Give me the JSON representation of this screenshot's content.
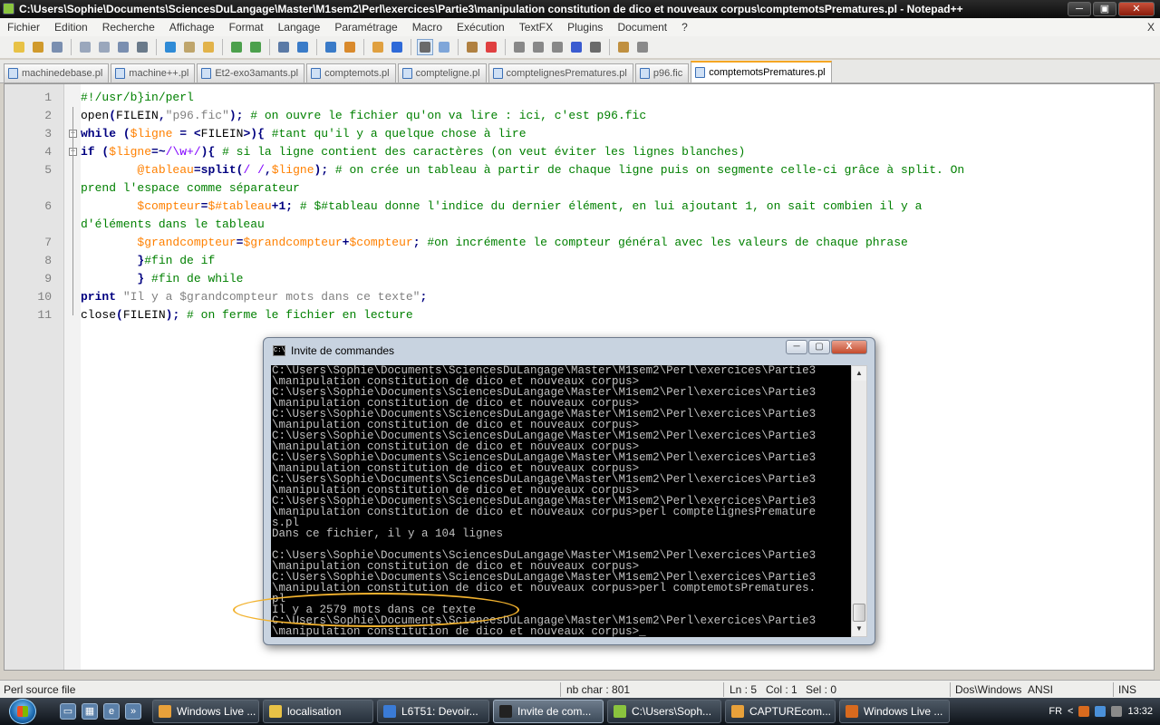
{
  "window": {
    "title": "C:\\Users\\Sophie\\Documents\\SciencesDuLangage\\Master\\M1sem2\\Perl\\exercices\\Partie3\\manipulation constitution de dico et nouveaux corpus\\comptemotsPrematures.pl - Notepad++",
    "buttons": {
      "minimize": "─",
      "maximize": "▣",
      "close": "✕"
    }
  },
  "menu": [
    "Fichier",
    "Edition",
    "Recherche",
    "Affichage",
    "Format",
    "Langage",
    "Paramétrage",
    "Macro",
    "Exécution",
    "TextFX",
    "Plugins",
    "Document",
    "?"
  ],
  "menu_close": "X",
  "toolbar_icon_colors": [
    "#e8c246",
    "#d09a2c",
    "#7a8fb0",
    "#9aa7bc",
    "#9aa7bc",
    "#7a8fb0",
    "#6a7a8a",
    "#2f8bd6",
    "#bfa56b",
    "#e2b34a",
    "#4ca04c",
    "#4ca04c",
    "#5b7aa6",
    "#3a7bc8",
    "#3a7bc8",
    "#d98a2c",
    "#e0a040",
    "#2f6ad8",
    "#6a6a6a",
    "#7fa6d9",
    "#b08040",
    "#e04040",
    "#888888",
    "#888888",
    "#888888",
    "#3a5bd0",
    "#6a6a6a",
    "#c09040",
    "#8a8a8a"
  ],
  "tabs": [
    {
      "label": "machinedebase.pl",
      "selected": false
    },
    {
      "label": "machine++.pl",
      "selected": false
    },
    {
      "label": "Et2-exo3amants.pl",
      "selected": false
    },
    {
      "label": "comptemots.pl",
      "selected": false
    },
    {
      "label": "compteligne.pl",
      "selected": false
    },
    {
      "label": "comptelignesPrematures.pl",
      "selected": false
    },
    {
      "label": "p96.fic",
      "selected": false
    },
    {
      "label": "comptemotsPrematures.pl",
      "selected": true
    }
  ],
  "code_lines": [
    {
      "num": "1",
      "tokens": [
        {
          "t": "#!/usr/b}in/perl",
          "c": "cm"
        }
      ]
    },
    {
      "num": "2",
      "tokens": [
        {
          "t": "open",
          "c": "pl"
        },
        {
          "t": "(",
          "c": "op"
        },
        {
          "t": "FILEIN",
          "c": "pl"
        },
        {
          "t": ",",
          "c": "op"
        },
        {
          "t": "\"p96.fic\"",
          "c": "st"
        },
        {
          "t": "); ",
          "c": "op"
        },
        {
          "t": "# on ouvre le fichier qu'on va lire : ici, c'est p96.fic",
          "c": "cm"
        }
      ]
    },
    {
      "num": "3",
      "tokens": [
        {
          "t": "while",
          "c": "kw"
        },
        {
          "t": " (",
          "c": "op"
        },
        {
          "t": "$ligne",
          "c": "vr"
        },
        {
          "t": " = <",
          "c": "op"
        },
        {
          "t": "FILEIN",
          "c": "pl"
        },
        {
          "t": ">){ ",
          "c": "op"
        },
        {
          "t": "#tant qu'il y a quelque chose à lire",
          "c": "cm"
        }
      ]
    },
    {
      "num": "4",
      "tokens": [
        {
          "t": "if",
          "c": "kw"
        },
        {
          "t": " (",
          "c": "op"
        },
        {
          "t": "$ligne",
          "c": "vr"
        },
        {
          "t": "=~",
          "c": "op"
        },
        {
          "t": "/\\w+/",
          "c": "rx"
        },
        {
          "t": "){ ",
          "c": "op"
        },
        {
          "t": "# si la ligne contient des caractères (on veut éviter les lignes blanches)",
          "c": "cm"
        }
      ]
    },
    {
      "num": "5",
      "tokens": [
        {
          "t": "        ",
          "c": "pl"
        },
        {
          "t": "@tableau",
          "c": "vr"
        },
        {
          "t": "=",
          "c": "op"
        },
        {
          "t": "split",
          "c": "kw"
        },
        {
          "t": "(",
          "c": "op"
        },
        {
          "t": "/ /",
          "c": "rx"
        },
        {
          "t": ",",
          "c": "op"
        },
        {
          "t": "$ligne",
          "c": "vr"
        },
        {
          "t": "); ",
          "c": "op"
        },
        {
          "t": "# on crée un tableau à partir de chaque ligne puis on segmente celle-ci grâce à split. On",
          "c": "cm"
        }
      ]
    },
    {
      "num": "",
      "tokens": [
        {
          "t": "prend l'espace comme séparateur",
          "c": "cm"
        }
      ]
    },
    {
      "num": "6",
      "tokens": [
        {
          "t": "        ",
          "c": "pl"
        },
        {
          "t": "$compteur",
          "c": "vr"
        },
        {
          "t": "=",
          "c": "op"
        },
        {
          "t": "$#tableau",
          "c": "vr"
        },
        {
          "t": "+1; ",
          "c": "op"
        },
        {
          "t": "# $#tableau donne l'indice du dernier élément, en lui ajoutant 1, on sait combien il y a",
          "c": "cm"
        }
      ]
    },
    {
      "num": "",
      "tokens": [
        {
          "t": "d'éléments dans le tableau",
          "c": "cm"
        }
      ]
    },
    {
      "num": "7",
      "tokens": [
        {
          "t": "        ",
          "c": "pl"
        },
        {
          "t": "$grandcompteur",
          "c": "vr"
        },
        {
          "t": "=",
          "c": "op"
        },
        {
          "t": "$grandcompteur",
          "c": "vr"
        },
        {
          "t": "+",
          "c": "op"
        },
        {
          "t": "$compteur",
          "c": "vr"
        },
        {
          "t": "; ",
          "c": "op"
        },
        {
          "t": "#on incrémente le compteur général avec les valeurs de chaque phrase",
          "c": "cm"
        }
      ]
    },
    {
      "num": "8",
      "tokens": [
        {
          "t": "        ",
          "c": "pl"
        },
        {
          "t": "}",
          "c": "op"
        },
        {
          "t": "#fin de if",
          "c": "cm"
        }
      ]
    },
    {
      "num": "9",
      "tokens": [
        {
          "t": "        ",
          "c": "pl"
        },
        {
          "t": "} ",
          "c": "op"
        },
        {
          "t": "#fin de while",
          "c": "cm"
        }
      ]
    },
    {
      "num": "10",
      "tokens": [
        {
          "t": "print",
          "c": "kw"
        },
        {
          "t": " ",
          "c": "pl"
        },
        {
          "t": "\"Il y a $grandcompteur mots dans ce texte\"",
          "c": "st"
        },
        {
          "t": ";",
          "c": "op"
        }
      ]
    },
    {
      "num": "11",
      "tokens": [
        {
          "t": "close",
          "c": "pl"
        },
        {
          "t": "(",
          "c": "op"
        },
        {
          "t": "FILEIN",
          "c": "pl"
        },
        {
          "t": "); ",
          "c": "op"
        },
        {
          "t": "# on ferme le fichier en lecture",
          "c": "cm"
        }
      ]
    }
  ],
  "cmd": {
    "title": "Invite de commandes",
    "icon_label": "C:\\",
    "buttons": {
      "minimize": "─",
      "maximize": "▢",
      "close": "X"
    },
    "lines": [
      "C:\\Users\\Sophie\\Documents\\SciencesDuLangage\\Master\\M1sem2\\Perl\\exercices\\Partie3",
      "\\manipulation constitution de dico et nouveaux corpus>",
      "C:\\Users\\Sophie\\Documents\\SciencesDuLangage\\Master\\M1sem2\\Perl\\exercices\\Partie3",
      "\\manipulation constitution de dico et nouveaux corpus>",
      "C:\\Users\\Sophie\\Documents\\SciencesDuLangage\\Master\\M1sem2\\Perl\\exercices\\Partie3",
      "\\manipulation constitution de dico et nouveaux corpus>",
      "C:\\Users\\Sophie\\Documents\\SciencesDuLangage\\Master\\M1sem2\\Perl\\exercices\\Partie3",
      "\\manipulation constitution de dico et nouveaux corpus>",
      "C:\\Users\\Sophie\\Documents\\SciencesDuLangage\\Master\\M1sem2\\Perl\\exercices\\Partie3",
      "\\manipulation constitution de dico et nouveaux corpus>",
      "C:\\Users\\Sophie\\Documents\\SciencesDuLangage\\Master\\M1sem2\\Perl\\exercices\\Partie3",
      "\\manipulation constitution de dico et nouveaux corpus>",
      "C:\\Users\\Sophie\\Documents\\SciencesDuLangage\\Master\\M1sem2\\Perl\\exercices\\Partie3",
      "\\manipulation constitution de dico et nouveaux corpus>perl comptelignesPremature",
      "s.pl",
      "Dans ce fichier, il y a 104 lignes",
      "",
      "C:\\Users\\Sophie\\Documents\\SciencesDuLangage\\Master\\M1sem2\\Perl\\exercices\\Partie3",
      "\\manipulation constitution de dico et nouveaux corpus>",
      "C:\\Users\\Sophie\\Documents\\SciencesDuLangage\\Master\\M1sem2\\Perl\\exercices\\Partie3",
      "\\manipulation constitution de dico et nouveaux corpus>perl comptemotsPrematures.",
      "pl",
      "Il y a 2579 mots dans ce texte",
      "C:\\Users\\Sophie\\Documents\\SciencesDuLangage\\Master\\M1sem2\\Perl\\exercices\\Partie3",
      "\\manipulation constitution de dico et nouveaux corpus>_"
    ],
    "scroll_up": "▲",
    "scroll_down": "▼",
    "highlight_color": "#f2b22e"
  },
  "status": {
    "file_type": "Perl source file",
    "nb_char": "nb char : 801",
    "ln": "Ln : 5",
    "col": "Col : 1",
    "sel": "Sel : 0",
    "eol": "Dos\\Windows",
    "encoding": "ANSI",
    "mode": "INS"
  },
  "taskbar": {
    "quicklaunch": [
      {
        "icon": "show-desktop-icon",
        "glyph": "▭"
      },
      {
        "icon": "switch-windows-icon",
        "glyph": "▦"
      },
      {
        "icon": "ie-icon",
        "glyph": "e"
      },
      {
        "icon": "more-chevron-icon",
        "glyph": "»"
      }
    ],
    "tasks": [
      {
        "label": "Windows Live ...",
        "icon_color": "#e8a13a",
        "active": false,
        "w": 118
      },
      {
        "label": "localisation",
        "icon_color": "#e8c246",
        "active": false,
        "w": 122
      },
      {
        "label": "L6T51: Devoir...",
        "icon_color": "#3a7bd6",
        "active": false,
        "w": 124
      },
      {
        "label": "Invite de com...",
        "icon_color": "#222222",
        "active": true,
        "w": 122
      },
      {
        "label": "C:\\Users\\Soph...",
        "icon_color": "#8ac43e",
        "active": false,
        "w": 126
      },
      {
        "label": "CAPTUREcom...",
        "icon_color": "#e8a13a",
        "active": false,
        "w": 122
      },
      {
        "label": "Windows Live ...",
        "icon_color": "#d86a1e",
        "active": false,
        "w": 122
      }
    ],
    "lang": "FR",
    "tray_arrow": "<",
    "clock": "13:32"
  }
}
